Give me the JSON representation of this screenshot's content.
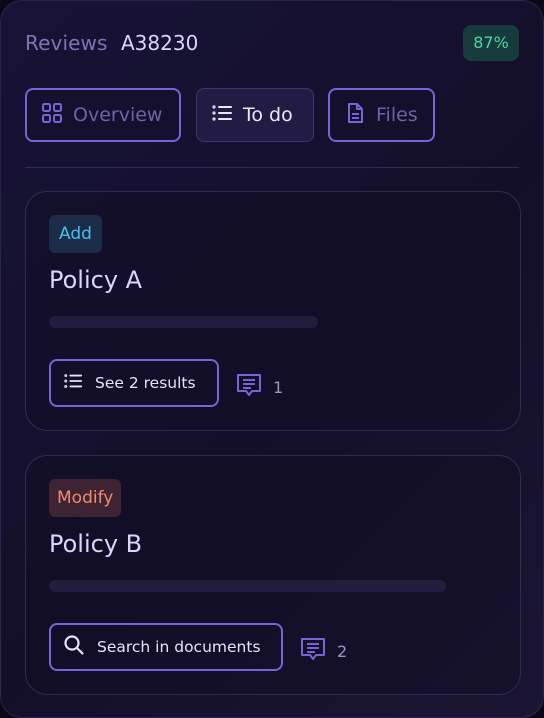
{
  "header": {
    "prefix": "Reviews",
    "id": "A38230",
    "percentage": "87%"
  },
  "tabs": [
    {
      "label": "Overview",
      "icon": "grid-icon",
      "active": false
    },
    {
      "label": "To do",
      "icon": "list-icon",
      "active": true
    },
    {
      "label": "Files",
      "icon": "document-icon",
      "active": false
    }
  ],
  "cards": [
    {
      "tag": "Add",
      "title": "Policy A",
      "action_label": "See 2 results",
      "action_icon": "list-icon",
      "comment_count": "1"
    },
    {
      "tag": "Modify",
      "title": "Policy B",
      "action_label": "Search in documents",
      "action_icon": "search-icon",
      "comment_count": "2"
    }
  ],
  "colors": {
    "accent": "#7b62d6",
    "tag_add": "#45c2e8",
    "tag_modify": "#f18b6e",
    "percent_green": "#4fd6a0"
  }
}
